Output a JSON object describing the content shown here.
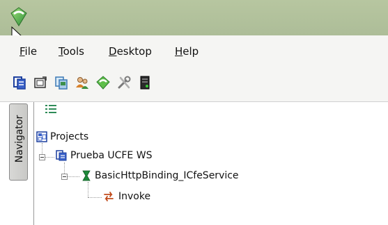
{
  "menu": {
    "items": [
      {
        "label": "File"
      },
      {
        "label": "Tools"
      },
      {
        "label": "Desktop"
      },
      {
        "label": "Help"
      }
    ]
  },
  "toolbar": {
    "icons": [
      "project-icon",
      "open-icon",
      "copy-icon",
      "users-icon",
      "refresh-icon",
      "tools-icon",
      "server-icon"
    ]
  },
  "sidebar": {
    "tab_label": "Navigator"
  },
  "tree": {
    "root": "Projects",
    "project": "Prueba UCFE WS",
    "binding": "BasicHttpBinding_ICfeService",
    "operation": "Invoke"
  },
  "colors": {
    "titlebar": "#b2c19c",
    "accent_green": "#2e8b57"
  }
}
